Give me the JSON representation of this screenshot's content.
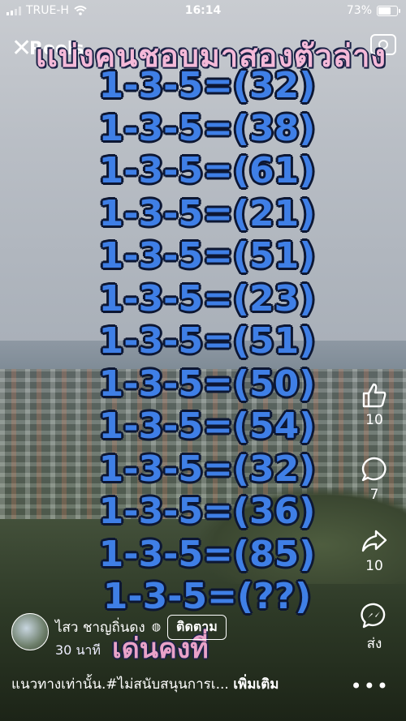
{
  "status_bar": {
    "carrier": "TRUE-H",
    "time": "16:14",
    "battery": "73%",
    "battery_level": 0.73
  },
  "top_bar": {
    "title": "Reels",
    "close_icon": "close-icon",
    "camera_icon": "camera-icon"
  },
  "video": {
    "title": "เเบ่งคนชอบมาสองตัวล่าง",
    "lines": [
      "1-3-5=(32)",
      "1-3-5=(38)",
      "1-3-5=(61)",
      "1-3-5=(21)",
      "1-3-5=(51)",
      "1-3-5=(23)",
      "1-3-5=(51)",
      "1-3-5=(50)",
      "1-3-5=(54)",
      "1-3-5=(32)",
      "1-3-5=(36)",
      "1-3-5=(85)",
      "1-3-5=(??)"
    ],
    "bottom_caption": "เด่นคงที่"
  },
  "actions": {
    "like": {
      "icon": "like-icon",
      "count": "10"
    },
    "comment": {
      "icon": "comment-icon",
      "count": "7"
    },
    "share": {
      "icon": "share-icon",
      "count": "10"
    },
    "send": {
      "icon": "messenger-icon",
      "label": "ส่ง"
    }
  },
  "author": {
    "name": "ไสว ชาญถิ่นดง",
    "follow_label": "ติดตาม",
    "time_ago": "30 นาที"
  },
  "description": {
    "text": "แนวทางเท่านั้น.#ไม่สนับสนุนการเ...",
    "more_label": "เพิ่มเติม"
  }
}
